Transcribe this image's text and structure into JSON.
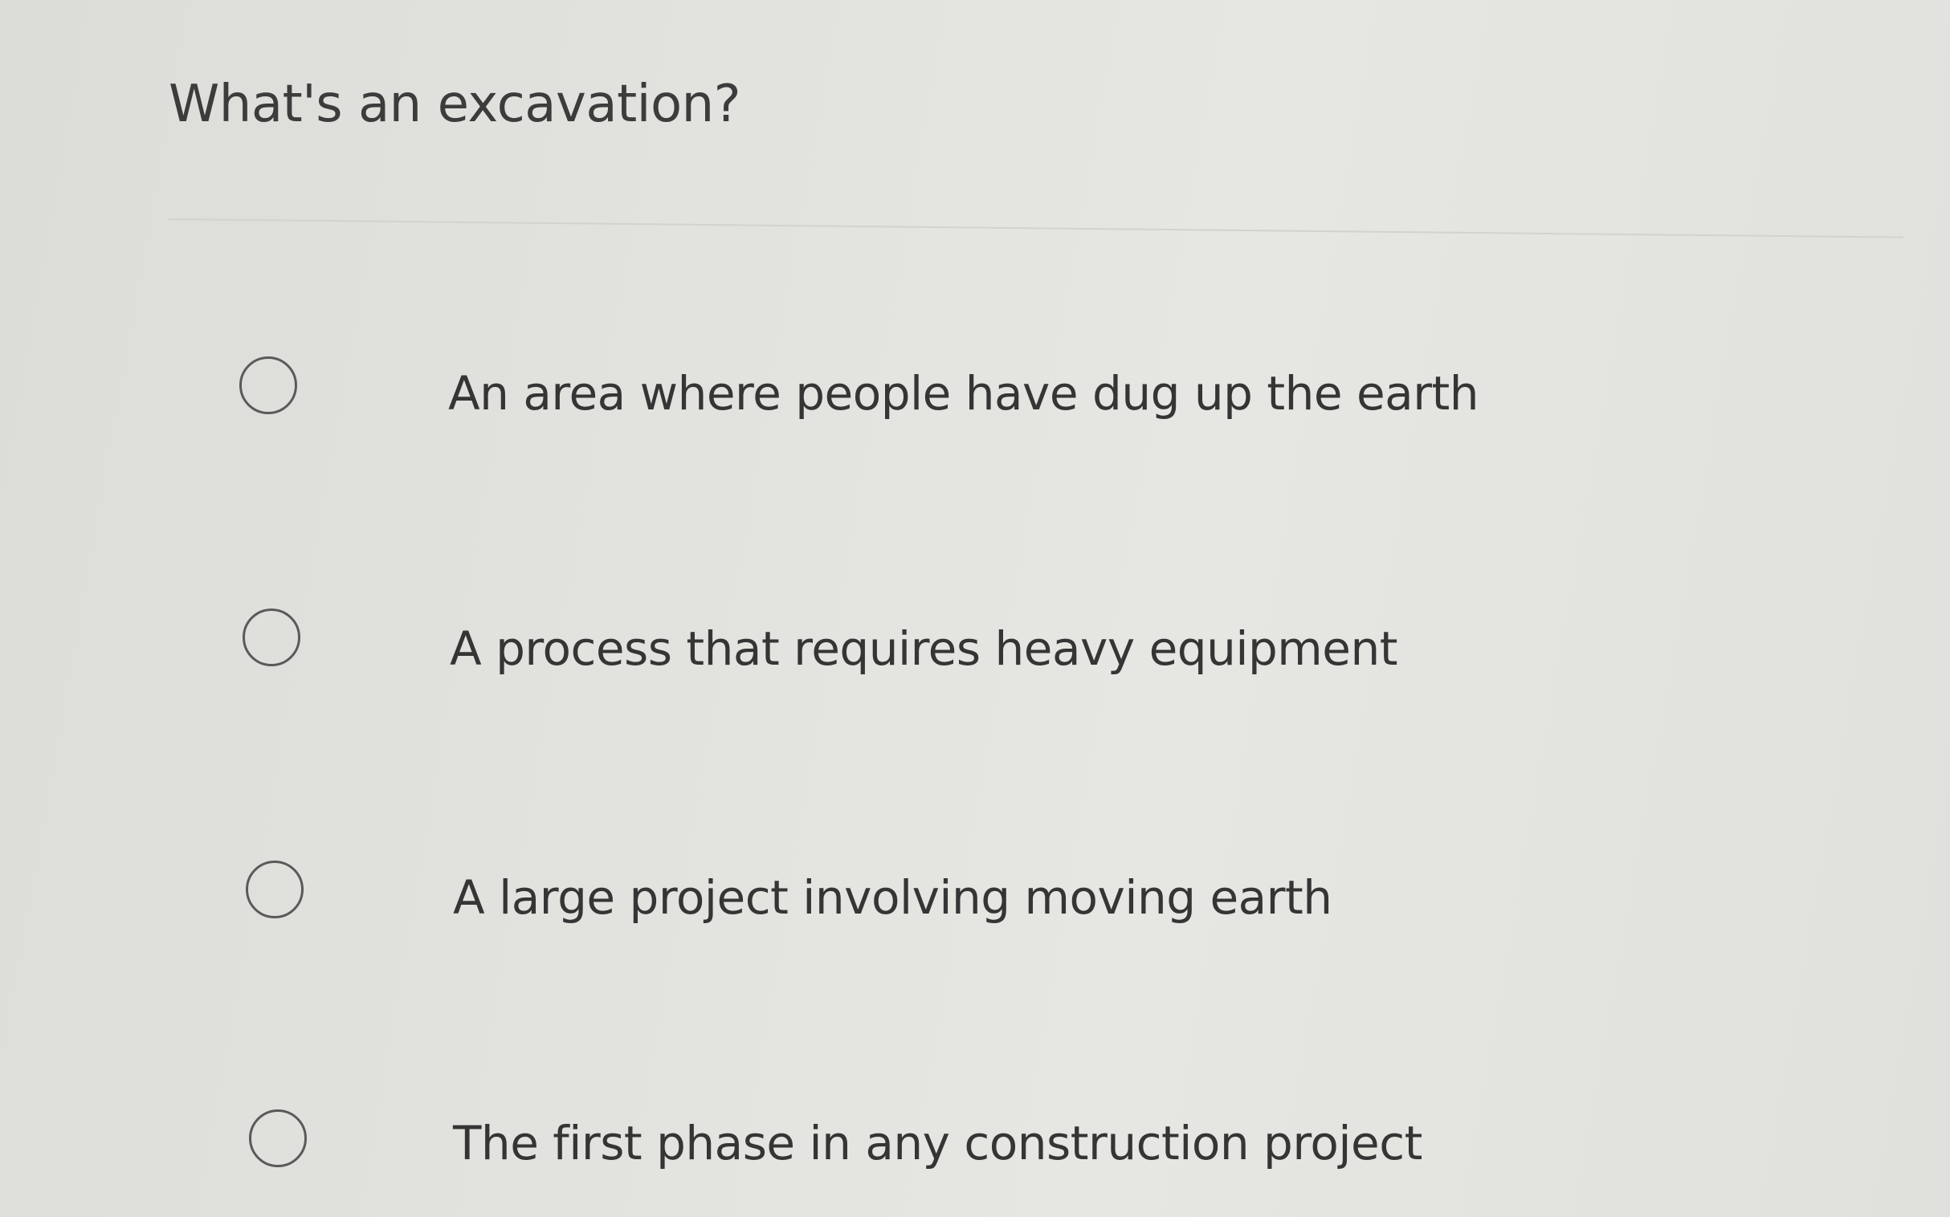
{
  "question": {
    "text": "What's an excavation?"
  },
  "options": [
    {
      "label": "An area where people have dug up the earth",
      "selected": false
    },
    {
      "label": "A process that requires heavy equipment",
      "selected": false
    },
    {
      "label": "A large project involving moving earth",
      "selected": false
    },
    {
      "label": "The first phase in any construction project",
      "selected": false
    }
  ],
  "colors": {
    "background": "#e2e2de",
    "text": "#3a3a3a",
    "radio_border": "#5a5a5a",
    "divider": "#d2d2ce"
  }
}
